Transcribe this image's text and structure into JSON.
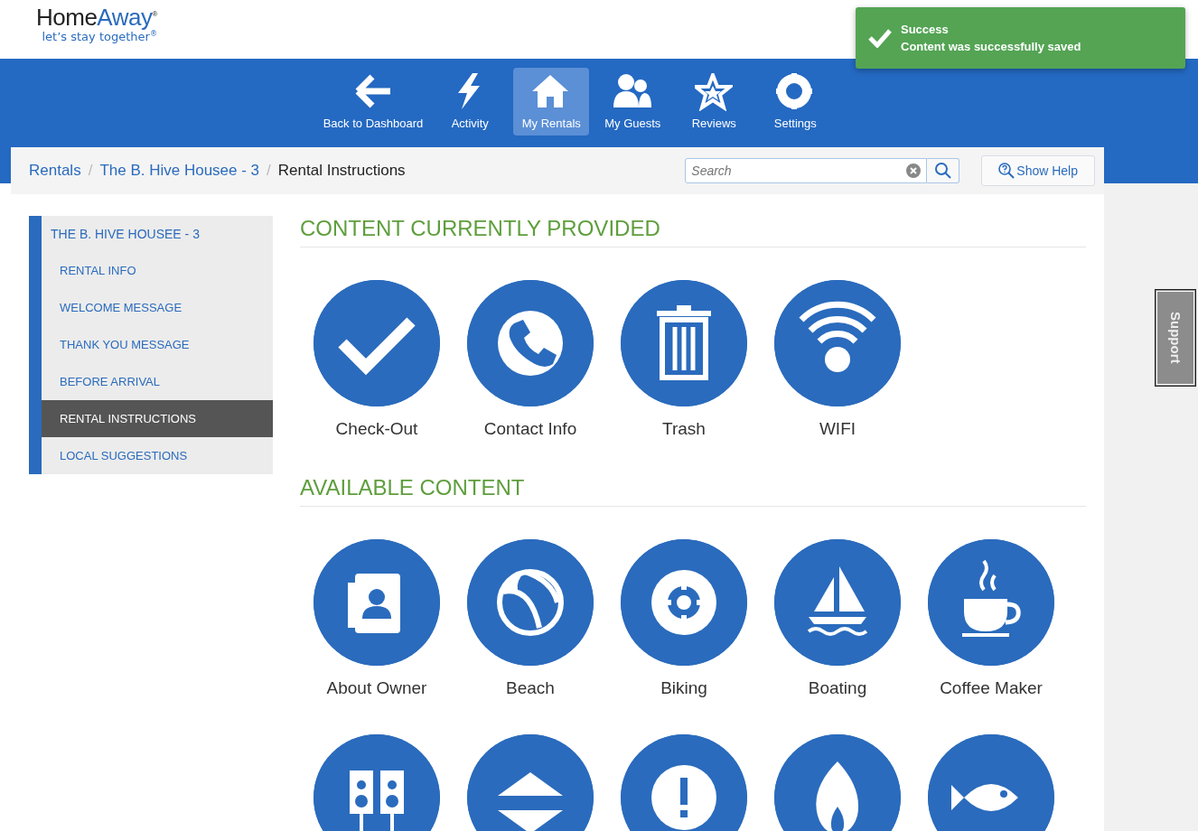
{
  "logo": {
    "name_dark": "Home",
    "name_light": "Away",
    "mark": "®",
    "tagline": "let’s stay together",
    "tagline_mark": "®"
  },
  "nav": [
    {
      "label": "Back to Dashboard",
      "selected": false
    },
    {
      "label": "Activity",
      "selected": false
    },
    {
      "label": "My Rentals",
      "selected": true
    },
    {
      "label": "My Guests",
      "selected": false
    },
    {
      "label": "Reviews",
      "selected": false
    },
    {
      "label": "Settings",
      "selected": false
    }
  ],
  "toast": {
    "title": "Success",
    "message": "Content was successfully saved"
  },
  "breadcrumb": [
    "Rentals",
    "The B. Hive Housee - 3",
    "Rental Instructions"
  ],
  "breadcrumb_separator": "/",
  "search": {
    "placeholder": "Search"
  },
  "help_button": "Show Help",
  "sidebar": {
    "title": "THE B. HIVE HOUSEE - 3",
    "items": [
      {
        "label": "RENTAL INFO",
        "selected": false
      },
      {
        "label": "WELCOME MESSAGE",
        "selected": false
      },
      {
        "label": "THANK YOU MESSAGE",
        "selected": false
      },
      {
        "label": "BEFORE ARRIVAL",
        "selected": false
      },
      {
        "label": "RENTAL INSTRUCTIONS",
        "selected": true
      },
      {
        "label": "LOCAL SUGGESTIONS",
        "selected": false
      }
    ]
  },
  "sections": [
    {
      "title": "CONTENT CURRENTLY PROVIDED",
      "tiles": [
        "Check-Out",
        "Contact Info",
        "Trash",
        "WIFI"
      ]
    },
    {
      "title": "AVAILABLE CONTENT",
      "tiles": [
        "About Owner",
        "Beach",
        "Biking",
        "Boating",
        "Coffee Maker"
      ]
    }
  ],
  "support_tab": "Support"
}
